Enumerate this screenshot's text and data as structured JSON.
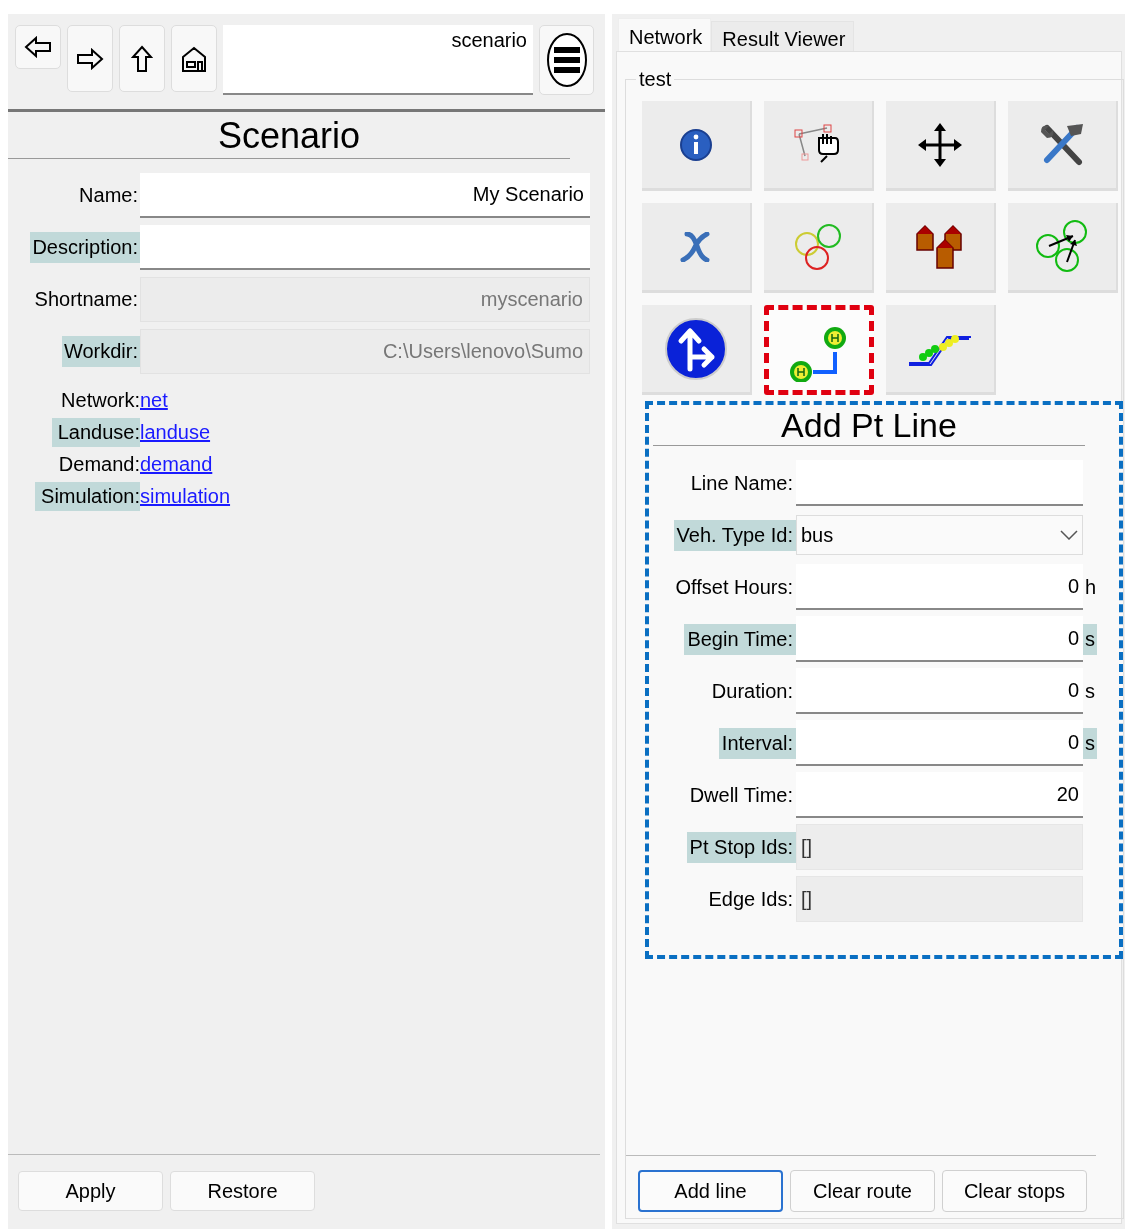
{
  "toolbar": {
    "nav_buttons": [
      {
        "kind": "back"
      },
      {
        "kind": "forward"
      },
      {
        "kind": "up"
      },
      {
        "kind": "home"
      }
    ],
    "path": {
      "value": "scenario"
    },
    "menu_button": {
      "kind": "menu"
    }
  },
  "scenario_panel": {
    "title": "Scenario",
    "fields": [
      {
        "label": "Name:",
        "value": "My Scenario",
        "highlighted": false,
        "disabled": false
      },
      {
        "label": "Description:",
        "highlighted": true,
        "disabled": false
      },
      {
        "label": "Shortname:",
        "value": "myscenario",
        "highlighted": false,
        "disabled": true
      },
      {
        "label": "Workdir:",
        "value": "C:\\Users\\lenovo\\Sumo",
        "highlighted": true,
        "disabled": true
      }
    ],
    "links": [
      {
        "label": "Network:",
        "link": "net",
        "highlighted": false
      },
      {
        "label": "Landuse:",
        "link": "landuse",
        "highlighted": true
      },
      {
        "label": "Demand:",
        "link": "demand",
        "highlighted": false
      },
      {
        "label": "Simulation:",
        "link": "simulation",
        "highlighted": true
      }
    ],
    "buttons": [
      "Apply",
      "Restore"
    ]
  },
  "tabs": [
    {
      "label": "Network",
      "selected": true
    },
    {
      "label": "Result Viewer",
      "selected": false
    }
  ],
  "group": {
    "title": "test",
    "tools": [
      {
        "kind": "info",
        "selected": false
      },
      {
        "kind": "select",
        "selected": false
      },
      {
        "kind": "move",
        "selected": false
      },
      {
        "kind": "tools",
        "selected": false
      },
      {
        "kind": "variable",
        "selected": false
      },
      {
        "kind": "circles",
        "selected": false
      },
      {
        "kind": "houses",
        "selected": false
      },
      {
        "kind": "flows",
        "selected": false
      },
      {
        "kind": "sign",
        "selected": false
      },
      {
        "kind": "ptline",
        "selected": true
      },
      {
        "kind": "lanes",
        "selected": false
      }
    ],
    "form": {
      "title": "Add Pt Line",
      "rows": [
        {
          "label": "Line Name:",
          "kind": "text",
          "highlighted": false
        },
        {
          "label": "Veh. Type Id:",
          "kind": "combo",
          "value": "bus",
          "highlighted": true
        },
        {
          "label": "Offset Hours:",
          "kind": "number",
          "value": "0",
          "unit": "h",
          "highlighted": false
        },
        {
          "label": "Begin Time:",
          "kind": "number",
          "value": "0",
          "unit": "s",
          "highlighted": true
        },
        {
          "label": "Duration:",
          "kind": "number",
          "value": "0",
          "unit": "s",
          "highlighted": false
        },
        {
          "label": "Interval:",
          "kind": "number",
          "value": "0",
          "unit": "s",
          "highlighted": true
        },
        {
          "label": "Dwell Time:",
          "kind": "number",
          "value": "20",
          "highlighted": false
        },
        {
          "label": "Pt Stop Ids:",
          "kind": "readonly",
          "value": "[]",
          "highlighted": true
        },
        {
          "label": "Edge Ids:",
          "kind": "readonly",
          "value": "[]",
          "highlighted": false
        }
      ]
    },
    "buttons": [
      {
        "label": "Add line",
        "default": true
      },
      {
        "label": "Clear route",
        "default": false
      },
      {
        "label": "Clear stops",
        "default": false
      }
    ]
  }
}
